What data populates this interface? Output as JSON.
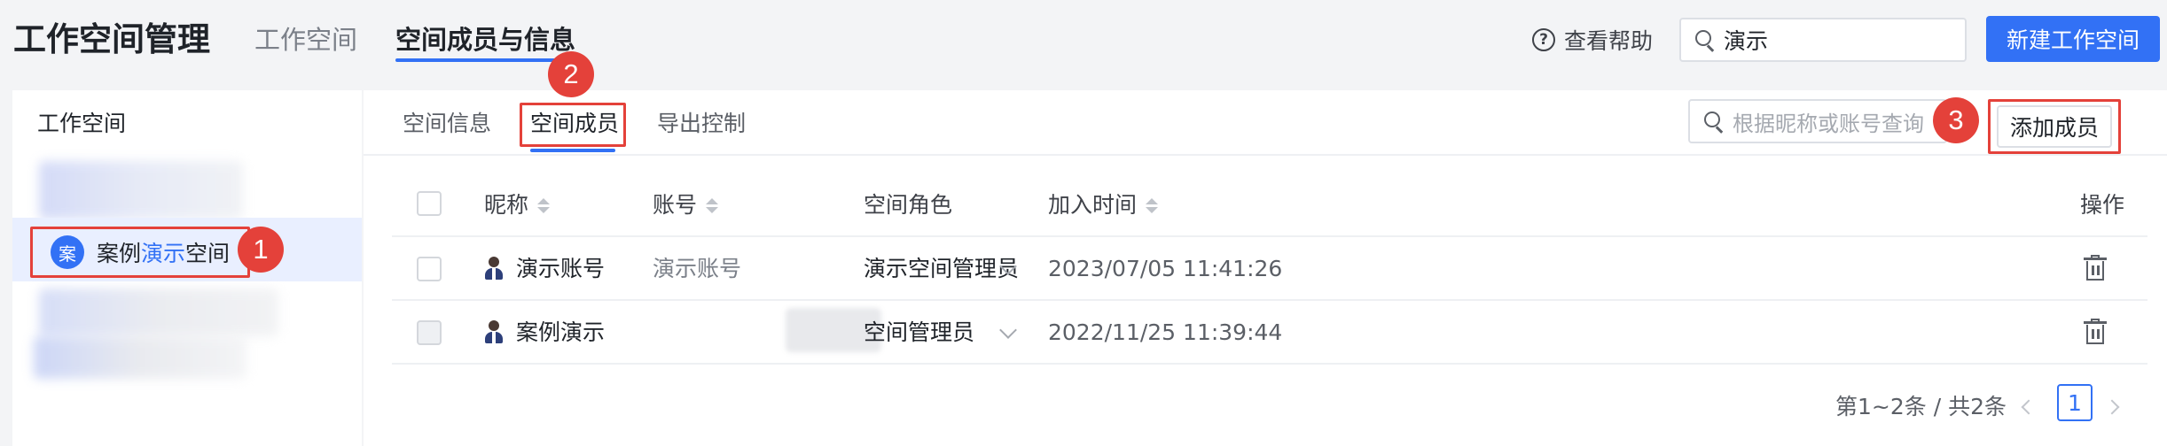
{
  "header": {
    "app_title": "工作空间管理",
    "tabs": [
      {
        "label": "工作空间"
      },
      {
        "label": "空间成员与信息"
      }
    ],
    "help_label": "查看帮助",
    "search_value": "演示",
    "new_workspace_label": "新建工作空间"
  },
  "sidebar": {
    "title": "工作空间",
    "selected_item": {
      "avatar": "案",
      "name_prefix": "案例",
      "name_highlight": "演示",
      "name_suffix": "空间"
    }
  },
  "main": {
    "sub_tabs": [
      {
        "label": "空间信息"
      },
      {
        "label": "空间成员"
      },
      {
        "label": "导出控制"
      }
    ],
    "member_search_placeholder": "根据昵称或账号查询",
    "add_member_label": "添加成员",
    "columns": {
      "nickname": "昵称",
      "account": "账号",
      "role": "空间角色",
      "joined": "加入时间",
      "actions": "操作"
    },
    "rows": [
      {
        "nickname": "演示账号",
        "account": "演示账号",
        "role": "演示空间管理员",
        "joined": "2023/07/05 11:41:26"
      },
      {
        "nickname": "案例演示",
        "account": "",
        "role": "空间管理员",
        "joined": "2022/11/25 11:39:44"
      }
    ],
    "pagination": {
      "summary": "第1~2条 / 共2条",
      "current_page": "1"
    }
  },
  "annotations": {
    "step1": "1",
    "step2": "2",
    "step3": "3"
  },
  "colors": {
    "accent": "#3271f5",
    "annotation": "#e4413a"
  },
  "icons": [
    "help-icon",
    "search-icon",
    "person-icon",
    "sort-icon",
    "chevron-down-icon",
    "trash-icon"
  ]
}
